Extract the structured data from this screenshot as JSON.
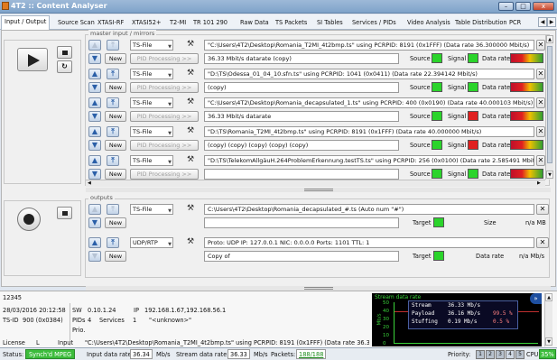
{
  "window": {
    "title": "4T2 :: Content Analyser",
    "min": "–",
    "max": "□",
    "close": "x"
  },
  "tabs": [
    "Input / Output",
    "Source Scan",
    "XTASI-RF",
    "XTASI52+",
    "T2-MI",
    "TR 101 290",
    "Raw Data",
    "TS Packets",
    "SI Tables",
    "Services / PIDs",
    "Video Analysis",
    "Table Distribution",
    "PCR",
    "Stream Capture",
    "About"
  ],
  "inputs_group": {
    "label": "master input / mirrors"
  },
  "outputs_group": {
    "label": "outputs"
  },
  "common": {
    "combo_value": "TS-File",
    "new": "New",
    "pid_processing": "PID Processing >>",
    "source": "Source",
    "signal": "Signal",
    "data_rate": "Data rate"
  },
  "inputs": [
    {
      "path": "\"C:\\Users\\4T2\\Desktop\\Romania_T2MI_4t2bmp.ts\" using PCRPID: 8191 (0x1FFF) (Data rate 36.300000 Mbit/s)",
      "status": "36.33 Mbit/s datarate (copy)",
      "source_color": "#2bd42b",
      "signal_color": "#2bd42b",
      "meter": true
    },
    {
      "path": "\"D:\\TS\\Odessa_01_04_10.sfn.ts\" using PCRPID: 1041 (0x0411) (Data rate 22.394142 Mbit/s)",
      "status": "(copy)",
      "source_color": "#2bd42b",
      "signal_color": "#2bd42b",
      "meter": true
    },
    {
      "path": "\"C:\\Users\\4T2\\Desktop\\Romania_decapsulated_1.ts\" using PCRPID: 400 (0x0190) (Data rate 40.000103 Mbit/s)",
      "status": "36.33 Mbit/s datarate",
      "source_color": "#2bd42b",
      "signal_color": "#e02020",
      "meter": true
    },
    {
      "path": "\"D:\\TS\\Romania_T2MI_4t2bmp.ts\" using PCRPID: 8191 (0x1FFF) (Data rate 40.000000 Mbit/s)",
      "status": "(copy) (copy) (copy) (copy) (copy)",
      "source_color": "#2bd42b",
      "signal_color": "#e02020",
      "meter": true
    },
    {
      "path": "\"D:\\TS\\TelekomAllgäuH.264ProblemErkennung.testTS.ts\" using PCRPID: 256 (0x0100) (Data rate 2.585491 Mbit/s)",
      "status": "",
      "source_color": "#2bd42b",
      "signal_color": "#2bd42b",
      "meter": true
    }
  ],
  "outputs": [
    {
      "type": "TS-File",
      "path": "C:\\Users\\4T2\\Desktop\\Romania_decapsulated_#.ts (Auto num \"#\")",
      "status": "",
      "target_label": "Target",
      "right_label": "Size",
      "right_value": "n/a MB"
    },
    {
      "type": "UDP/RTP",
      "path": "Proto: UDP IP: 127.0.0.1 NIC: 0.0.0.0 Ports: 1101 TTL: 1",
      "status": "Copy of",
      "target_label": "Target",
      "right_label": "Data rate",
      "right_value": "n/a Mb/s"
    }
  ],
  "info": {
    "code": "12345",
    "datetime": "28/03/2016 20:12:58",
    "sw_label": "SW",
    "sw": "0.10.1.24",
    "ip_label": "IP",
    "ip": "192.168.1.67,192.168.56.1",
    "tsid_label": "TS-ID",
    "tsid": "900 (0x0384)",
    "pids_label": "PIDs",
    "pids": "4",
    "services_label": "Services",
    "services": "1",
    "service_name": "\"<unknown>\"",
    "prio_label": "Prio.",
    "license_label": "License",
    "license": "L",
    "input_label": "Input",
    "input_path": "\"C:\\Users\\4T2\\Desktop\\Romania_T2MI_4t2bmp.ts\" using PCRPID: 8191 (0x1FFF) (Data rate 36.300000 Mbit/s)"
  },
  "graph": {
    "title": "Stream data rate",
    "ylabel": "Mb/s",
    "yticks": [
      "50",
      "40",
      "30",
      "20",
      "10",
      "0"
    ],
    "rows": [
      {
        "label": "Stream",
        "value": "36.33 Mb/s",
        "pct": ""
      },
      {
        "label": "Payload",
        "value": "36.16 Mb/s",
        "pct": "99.5 %"
      },
      {
        "label": "Stuffing",
        "value": "0.19 Mb/s",
        "pct": "0.5 %"
      }
    ]
  },
  "status": {
    "label": "Status:",
    "state": "Synch'd MPEG",
    "input_rate_label": "Input data rate:",
    "input_rate": "36.34",
    "unit1": "Mb/s",
    "stream_rate_label": "Stream data rate:",
    "stream_rate": "36.33",
    "unit2": "Mb/s",
    "packets_label": "Packets:",
    "packets": "188/188",
    "priority_label": "Priority:",
    "priorities": [
      "1",
      "2",
      "3",
      "4",
      "5"
    ],
    "cpu_label": "CPU",
    "cpu": "35%"
  },
  "colors": {
    "accent": "#2a5fa8",
    "ok": "#2bd42b",
    "error": "#e02020"
  }
}
